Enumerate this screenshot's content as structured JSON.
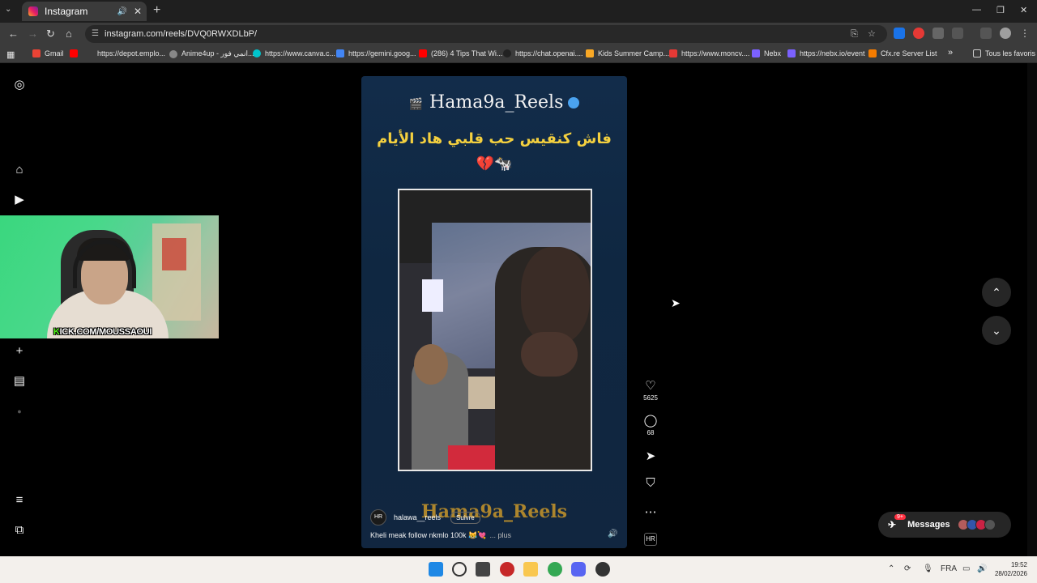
{
  "browser": {
    "tab_title": "Instagram",
    "url": "instagram.com/reels/DVQ0RWXDLbP/",
    "bookmarks": [
      {
        "label": "Gmail",
        "color": "#ea4335"
      },
      {
        "label": "https://depot.emplo...",
        "color": "#ff0000"
      },
      {
        "label": "Anime4up - انمي فور...",
        "color": "#888888"
      },
      {
        "label": "https://www.canva.c...",
        "color": "#00c4cc"
      },
      {
        "label": "https://gemini.goog...",
        "color": "#4285f4"
      },
      {
        "label": "(286) 4 Tips That Wi...",
        "color": "#ff0000"
      },
      {
        "label": "https://chat.openai....",
        "color": "#222222"
      },
      {
        "label": "Kids Summer Camp...",
        "color": "#f9a825"
      },
      {
        "label": "https://www.moncv....",
        "color": "#e53935"
      },
      {
        "label": "Nebx",
        "color": "#7b61ff"
      },
      {
        "label": "https://nebx.io/event",
        "color": "#7b61ff"
      },
      {
        "label": "Cfx.re Server List",
        "color": "#f57c00"
      }
    ],
    "all_bookmarks_label": "Tous les favoris"
  },
  "webcam": {
    "overlay_text": "KICK.COM/MOUSSAOUI",
    "overlay_k": "K"
  },
  "reel": {
    "handle": "Hama9a_Reels",
    "caption_ar": "فاش كنقيس حب قلبي هاد الأيام",
    "caption_emoji": "💔🐄",
    "watermark": "Hama9a_Reels",
    "username": "halawa__reels",
    "avatar_text": "HR",
    "follow_label": "Suivre",
    "description": "Kheli meak follow nkmlo 100k 😹💘",
    "more_label": "... plus"
  },
  "actions": {
    "likes": "5625",
    "comments": "68"
  },
  "messages": {
    "label": "Messages",
    "badge": "9+"
  },
  "taskbar": {
    "lang": "FRA",
    "time": "19:52",
    "date": "28/02/2026"
  }
}
